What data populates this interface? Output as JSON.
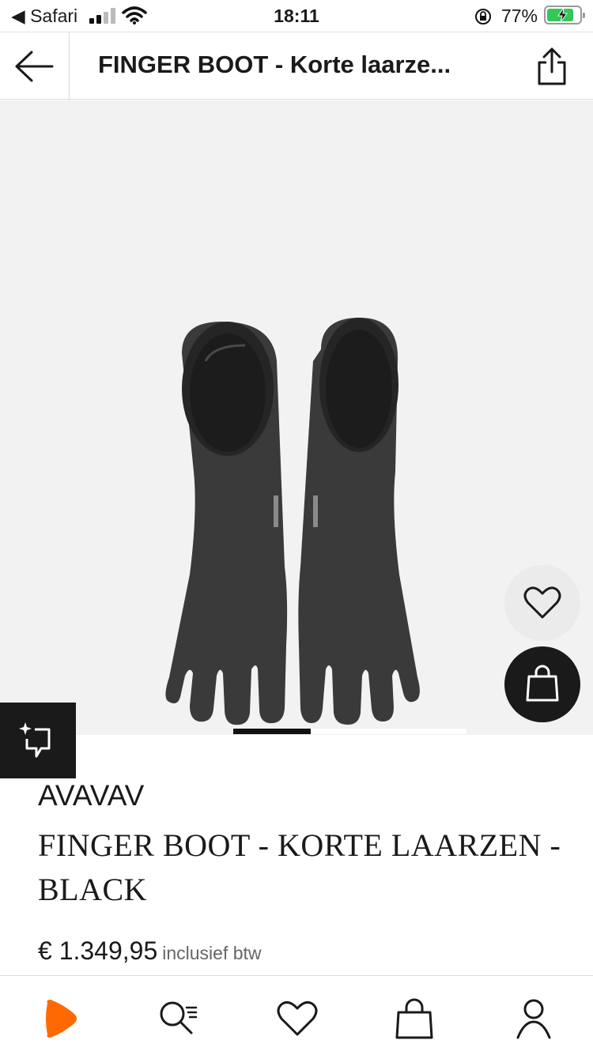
{
  "status_bar": {
    "back_app": "◀ Safari",
    "time": "18:11",
    "battery_percent": "77%",
    "battery_level": 0.77,
    "icons": [
      "signal-icon",
      "wifi-icon",
      "rotation-lock-icon",
      "battery-charging-icon"
    ]
  },
  "nav": {
    "title": "FINGER BOOT - Korte laarze...",
    "icons": [
      "back-arrow-icon",
      "share-icon"
    ]
  },
  "gallery": {
    "image_description": "black leather finger boots",
    "page_indicator": {
      "current": 1,
      "total": 3
    },
    "buttons": [
      "heart-icon",
      "shopping-bag-icon",
      "ar-view-icon"
    ]
  },
  "product": {
    "brand": "AVAVAV",
    "name": "FINGER BOOT - KORTE LAARZEN - BLACK",
    "price": "€ 1.349,95",
    "vat_note": "inclusief btw"
  },
  "tabbar": {
    "items": [
      "home-icon",
      "search-icon",
      "wishlist-icon",
      "bag-icon",
      "account-icon"
    ],
    "brand_color": "#ff6900"
  }
}
